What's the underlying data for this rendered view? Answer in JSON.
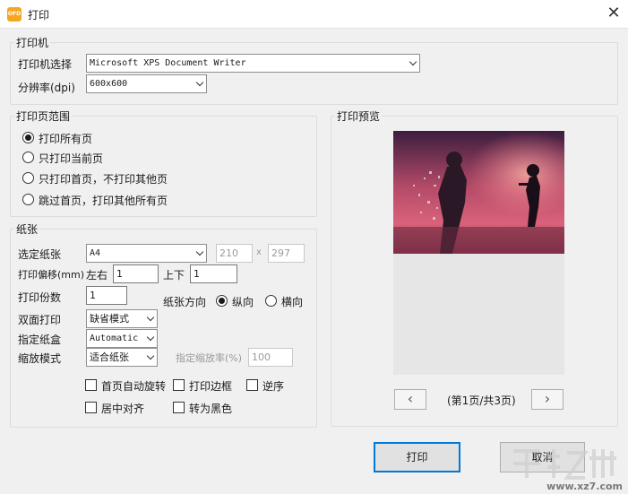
{
  "window": {
    "title": "打印",
    "app_icon_text": "OFD",
    "close_symbol": "✕"
  },
  "printer": {
    "group_label": "打印机",
    "select_label": "打印机选择",
    "selected_printer": "Microsoft XPS Document Writer",
    "resolution_label": "分辨率(dpi)",
    "resolution_value": "600x600"
  },
  "page_range": {
    "group_label": "打印页范围",
    "options": [
      {
        "label": "打印所有页",
        "checked": true
      },
      {
        "label": "只打印当前页",
        "checked": false
      },
      {
        "label": "只打印首页，不打印其他页",
        "checked": false
      },
      {
        "label": "跳过首页，打印其他所有页",
        "checked": false
      }
    ]
  },
  "paper": {
    "group_label": "纸张",
    "size_label": "选定纸张",
    "size_value": "A4",
    "width": "210",
    "x_sep": "x",
    "height": "297",
    "offset_label": "打印偏移(mm)",
    "lr_label": "左右",
    "lr_value": "1",
    "ud_label": "上下",
    "ud_value": "1",
    "copies_label": "打印份数",
    "copies_value": "1",
    "orientation_label": "纸张方向",
    "portrait_label": "纵向",
    "landscape_label": "横向",
    "duplex_label": "双面打印",
    "duplex_value": "缺省模式",
    "tray_label": "指定纸盒",
    "tray_value": "Automatic",
    "scale_label": "缩放模式",
    "scale_value": "适合纸张",
    "zoom_label": "指定缩放率(%)",
    "zoom_value": "100",
    "checks": {
      "auto_rotate": "首页自动旋转",
      "print_border": "打印边框",
      "reverse": "逆序",
      "center": "居中对齐",
      "to_black": "转为黑色"
    }
  },
  "preview": {
    "group_label": "打印预览",
    "page_info": "(第1页/共3页)",
    "prev_symbol": "‹",
    "next_symbol": "›"
  },
  "buttons": {
    "print": "打印",
    "cancel": "取消"
  },
  "watermark": {
    "text": "www.xz7.com"
  }
}
